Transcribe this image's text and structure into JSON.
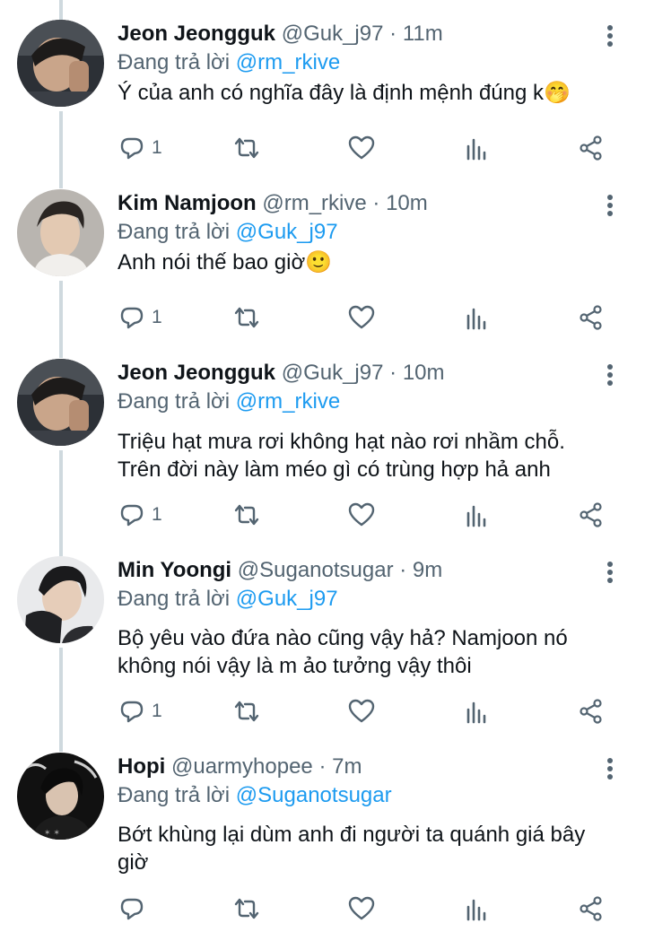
{
  "reply_prefix": "Đang trả lời",
  "tweets": [
    {
      "name": "Jeon Jeongguk",
      "handle": "@Guk_j97",
      "time": "11m",
      "reply_to": "@rm_rkive",
      "text_lines": [
        "Ý của anh có nghĩa đây là định mệnh đúng k🤭"
      ],
      "reply_count": "1"
    },
    {
      "name": "Kim Namjoon",
      "handle": "@rm_rkive",
      "time": "10m",
      "reply_to": "@Guk_j97",
      "text_lines": [
        "Anh nói thế bao giờ🙂"
      ],
      "reply_count": "1"
    },
    {
      "name": "Jeon Jeongguk",
      "handle": "@Guk_j97",
      "time": "10m",
      "reply_to": "@rm_rkive",
      "text_lines": [
        "Triệu hạt mưa rơi không hạt nào rơi nhầm chỗ.",
        "Trên đời này làm méo gì có trùng hợp hả anh"
      ],
      "reply_count": "1"
    },
    {
      "name": "Min Yoongi",
      "handle": "@Suganotsugar",
      "time": "9m",
      "reply_to": "@Guk_j97",
      "text_lines": [
        "Bộ yêu vào đứa nào cũng vậy hả? Namjoon nó",
        "không nói vậy là m ảo tưởng vậy thôi"
      ],
      "reply_count": "1"
    },
    {
      "name": "Hopi",
      "handle": "@uarmyhopee",
      "time": "7m",
      "reply_to": "@Suganotsugar",
      "text_lines": [
        "Bớt khùng lại dùm anh đi người ta quánh giá bây",
        "giờ"
      ],
      "reply_count": ""
    }
  ],
  "colors": {
    "name": "#0f1419",
    "secondary": "#536471",
    "mention": "#1d9bf0",
    "thread_line": "#cfd9de"
  }
}
